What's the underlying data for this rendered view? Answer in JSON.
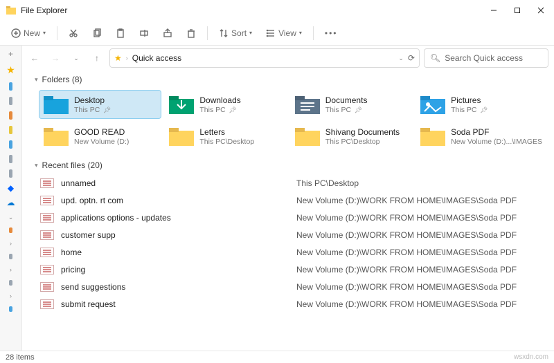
{
  "window": {
    "title": "File Explorer"
  },
  "toolbar": {
    "new": "New",
    "sort": "Sort",
    "view": "View"
  },
  "nav": {
    "location": "Quick access",
    "search_placeholder": "Search Quick access"
  },
  "sections": {
    "folders_label": "Folders (8)",
    "recent_label": "Recent files (20)"
  },
  "folders": [
    {
      "name": "Desktop",
      "path": "This PC",
      "pinned": true,
      "color": "blue",
      "selected": true
    },
    {
      "name": "Downloads",
      "path": "This PC",
      "pinned": true,
      "color": "teal"
    },
    {
      "name": "Documents",
      "path": "This PC",
      "pinned": true,
      "color": "slate"
    },
    {
      "name": "Pictures",
      "path": "This PC",
      "pinned": true,
      "color": "sky"
    },
    {
      "name": "GOOD READ",
      "path": "New Volume (D:)",
      "pinned": false,
      "color": "yellow"
    },
    {
      "name": "Letters",
      "path": "This PC\\Desktop",
      "pinned": false,
      "color": "yellow"
    },
    {
      "name": "Shivang Documents",
      "path": "This PC\\Desktop",
      "pinned": false,
      "color": "yellow"
    },
    {
      "name": "Soda PDF",
      "path": "New Volume (D:)...\\IMAGES",
      "pinned": false,
      "color": "yellow"
    }
  ],
  "recent": [
    {
      "name": "unnamed",
      "path": "This PC\\Desktop"
    },
    {
      "name": "upd. optn. rt com",
      "path": "New Volume (D:)\\WORK FROM HOME\\IMAGES\\Soda PDF"
    },
    {
      "name": "applications options - updates",
      "path": "New Volume (D:)\\WORK FROM HOME\\IMAGES\\Soda PDF"
    },
    {
      "name": "customer supp",
      "path": "New Volume (D:)\\WORK FROM HOME\\IMAGES\\Soda PDF"
    },
    {
      "name": "home",
      "path": "New Volume (D:)\\WORK FROM HOME\\IMAGES\\Soda PDF"
    },
    {
      "name": "pricing",
      "path": "New Volume (D:)\\WORK FROM HOME\\IMAGES\\Soda PDF"
    },
    {
      "name": "send suggestions",
      "path": "New Volume (D:)\\WORK FROM HOME\\IMAGES\\Soda PDF"
    },
    {
      "name": "submit request",
      "path": "New Volume (D:)\\WORK FROM HOME\\IMAGES\\Soda PDF"
    }
  ],
  "status": {
    "items": "28 items"
  },
  "footer": {
    "site": "wsxdn.com"
  }
}
